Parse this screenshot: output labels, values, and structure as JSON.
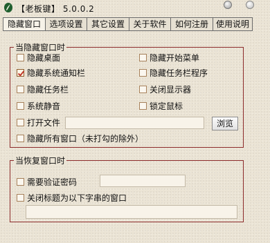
{
  "titlebar": {
    "title": "【老板键】 5.0.0.2",
    "icon": "green-leaf-app-icon"
  },
  "tabs": [
    {
      "label": "隐藏窗口",
      "active": true
    },
    {
      "label": "选项设置",
      "active": false
    },
    {
      "label": "其它设置",
      "active": false
    },
    {
      "label": "关于软件",
      "active": false
    },
    {
      "label": "如何注册",
      "active": false
    },
    {
      "label": "使用说明",
      "active": false
    }
  ],
  "hide_group": {
    "title": "当隐藏窗口时",
    "options": {
      "hide_desktop": {
        "label": "隐藏桌面",
        "checked": false
      },
      "hide_start_menu": {
        "label": "隐藏开始菜单",
        "checked": false
      },
      "hide_tray": {
        "label": "隐藏系统通知栏",
        "checked": true
      },
      "hide_taskbar_apps": {
        "label": "隐藏任务栏程序",
        "checked": false
      },
      "hide_taskbar": {
        "label": "隐藏任务栏",
        "checked": false
      },
      "close_monitor": {
        "label": "关闭显示器",
        "checked": false
      },
      "mute": {
        "label": "系统静音",
        "checked": false
      },
      "lock_mouse": {
        "label": "锁定鼠标",
        "checked": false
      },
      "open_file": {
        "label": "打开文件",
        "checked": false
      },
      "hide_all": {
        "label": "隐藏所有窗口（未打勾的除外）",
        "checked": false
      }
    },
    "open_file_value": "",
    "browse_label": "浏览"
  },
  "restore_group": {
    "title": "当恢复窗口时",
    "options": {
      "require_password": {
        "label": "需要验证密码",
        "checked": false
      },
      "close_titled": {
        "label": "关闭标题为以下字串的窗口",
        "checked": false
      }
    },
    "password_value": "",
    "title_string_value": ""
  },
  "colors": {
    "group_border": "#8c2a2a",
    "check_mark": "#c0392b",
    "background": "#ebe4d5"
  }
}
